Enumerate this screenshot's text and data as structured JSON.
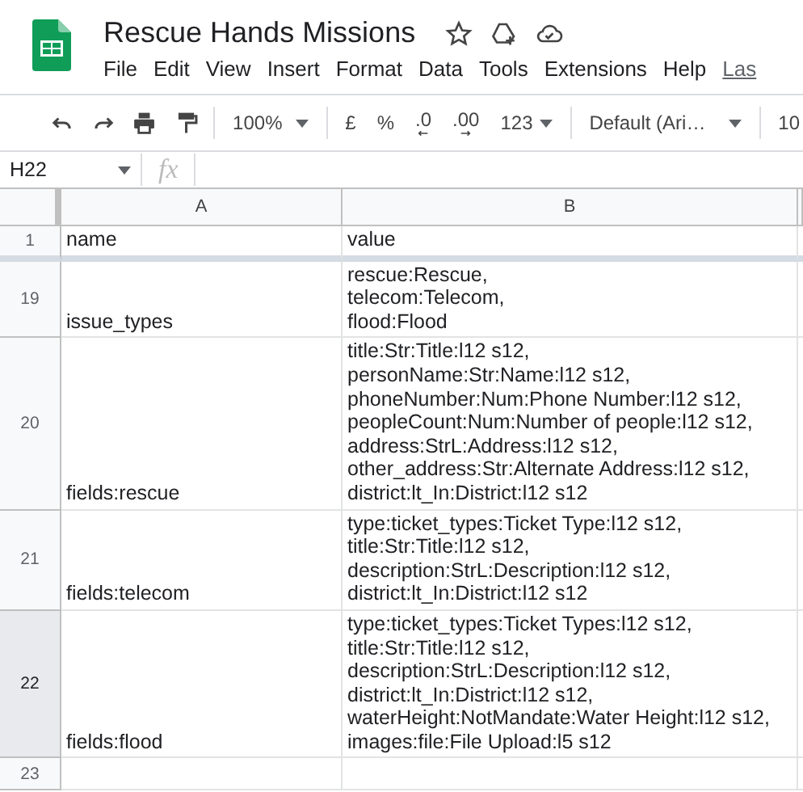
{
  "document": {
    "title": "Rescue Hands Missions"
  },
  "menu": [
    "File",
    "Edit",
    "View",
    "Insert",
    "Format",
    "Data",
    "Tools",
    "Extensions",
    "Help",
    "Las"
  ],
  "toolbar": {
    "zoom": "100%",
    "currency": "£",
    "percent": "%",
    "decrease_decimals": ".0",
    "increase_decimals": ".00",
    "number_format": "123",
    "font": "Default (Ari…",
    "font_size": "10"
  },
  "formula_bar": {
    "name_box": "H22",
    "fx": "fx"
  },
  "columns": [
    "A",
    "B"
  ],
  "frozen_rows": [
    {
      "number": "1",
      "selected": false,
      "cells": [
        "name",
        "value"
      ]
    }
  ],
  "rows": [
    {
      "number": "19",
      "selected": false,
      "cells": [
        "issue_types",
        "rescue:Rescue,\ntelecom:Telecom,\nflood:Flood"
      ]
    },
    {
      "number": "20",
      "selected": false,
      "cells": [
        "fields:rescue",
        "title:Str:Title:l12 s12,\npersonName:Str:Name:l12 s12,\nphoneNumber:Num:Phone Number:l12 s12,\npeopleCount:Num:Number of people:l12 s12,\naddress:StrL:Address:l12 s12,\nother_address:Str:Alternate Address:l12 s12,\ndistrict:lt_In:District:l12 s12"
      ]
    },
    {
      "number": "21",
      "selected": false,
      "cells": [
        "fields:telecom",
        "type:ticket_types:Ticket Type:l12 s12,\ntitle:Str:Title:l12 s12,\ndescription:StrL:Description:l12 s12,\ndistrict:lt_In:District:l12 s12"
      ]
    },
    {
      "number": "22",
      "selected": true,
      "cells": [
        "fields:flood",
        "type:ticket_types:Ticket Types:l12 s12,\ntitle:Str:Title:l12 s12,\ndescription:StrL:Description:l12 s12,\ndistrict:lt_In:District:l12 s12,\nwaterHeight:NotMandate:Water Height:l12 s12,\nimages:file:File Upload:l5 s12"
      ]
    },
    {
      "number": "23",
      "selected": false,
      "cells": []
    }
  ]
}
